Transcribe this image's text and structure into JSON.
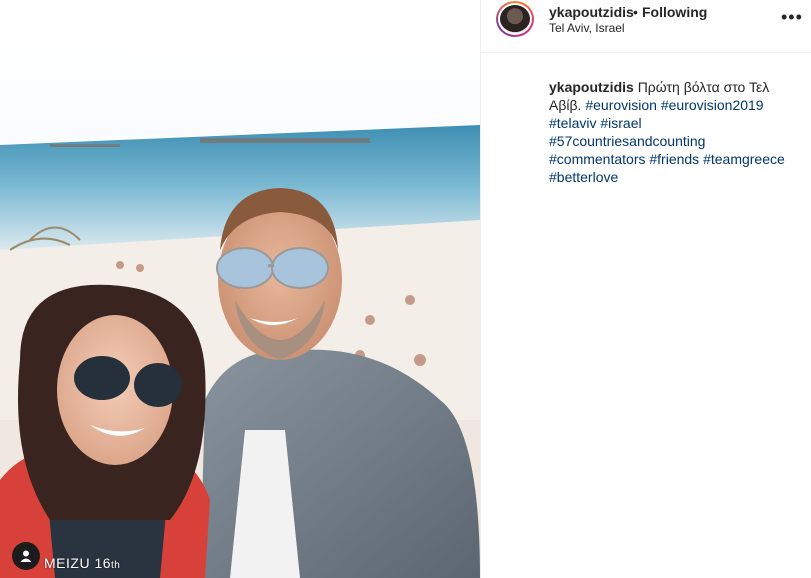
{
  "post": {
    "username": "ykapoutzidis",
    "separator": "•",
    "follow_status": "Following",
    "location": "Tel Aviv, Israel",
    "more_icon": "more-horizontal-icon",
    "caption_text": "Πρώτη βόλτα στο Τελ Αβίβ.",
    "hashtags": [
      "#eurovision",
      "#eurovision2019",
      "#telaviv",
      "#israel",
      "#57countriesandcounting",
      "#commentators",
      "#friends",
      "#teamgreece",
      "#betterlove"
    ]
  },
  "photo": {
    "watermark_brand": "MEIZU 16",
    "watermark_suffix": "th",
    "tag_icon": "user-tag-icon"
  },
  "colors": {
    "hashtag": "#00376b",
    "text": "#262626",
    "border": "#efefef",
    "sea": "#4f9fc0",
    "sky": "#f4f7fa"
  }
}
